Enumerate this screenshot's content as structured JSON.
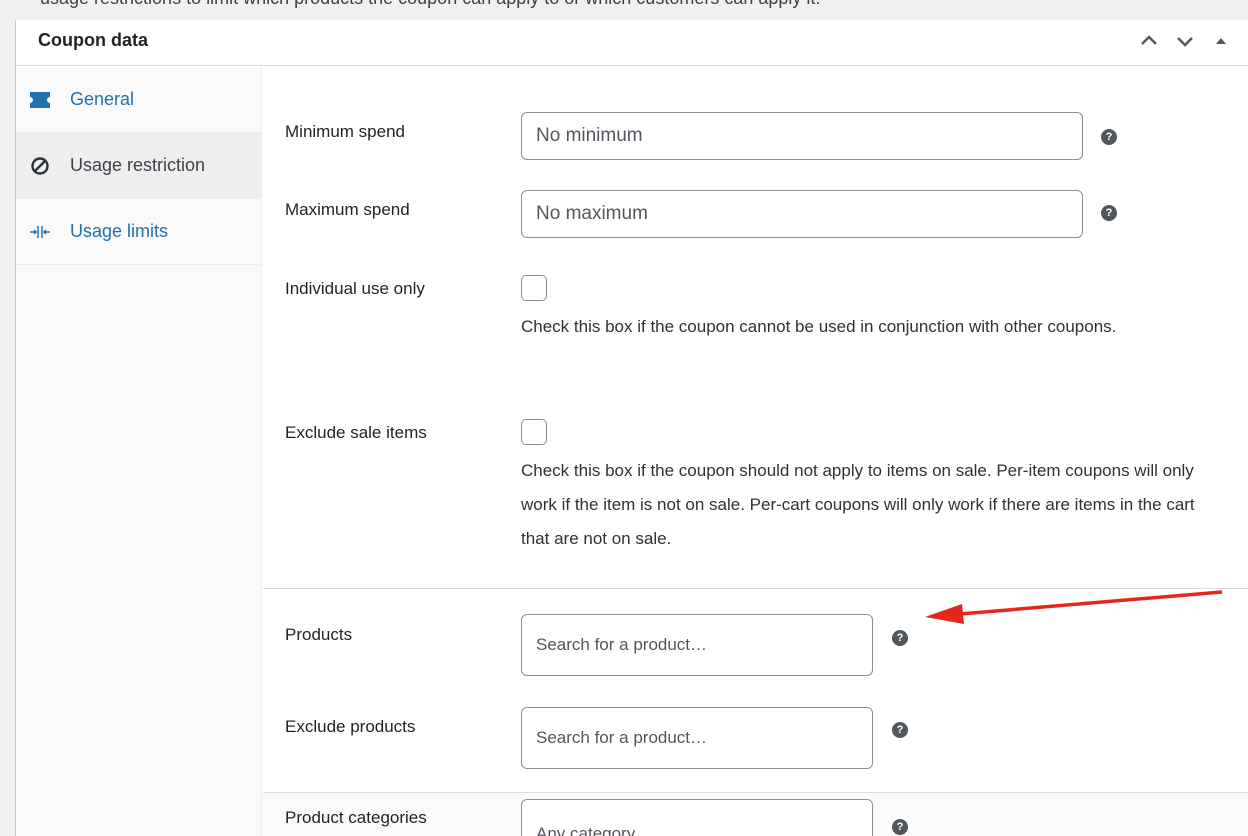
{
  "top_strip": {
    "clipped_text": "usage restrictions to limit which products the coupon can apply to or which customers can apply it."
  },
  "metabox": {
    "title": "Coupon data",
    "actions": [
      "move-up",
      "move-down",
      "toggle-panel"
    ]
  },
  "tabs": [
    {
      "label": "General",
      "icon": "ticket-icon",
      "active": false
    },
    {
      "label": "Usage restriction",
      "icon": "block-icon",
      "active": true
    },
    {
      "label": "Usage limits",
      "icon": "limits-icon",
      "active": false
    }
  ],
  "fields": {
    "minimum_spend": {
      "label": "Minimum spend",
      "placeholder": "No minimum"
    },
    "maximum_spend": {
      "label": "Maximum spend",
      "placeholder": "No maximum"
    },
    "individual_use": {
      "label": "Individual use only",
      "checked": false,
      "description": "Check this box if the coupon cannot be used in conjunction with other coupons."
    },
    "exclude_sale_items": {
      "label": "Exclude sale items",
      "checked": false,
      "description": "Check this box if the coupon should not apply to items on sale. Per-item coupons will only work if the item is not on sale. Per-cart coupons will only work if there are items in the cart that are not on sale."
    },
    "products": {
      "label": "Products",
      "placeholder": "Search for a product…"
    },
    "exclude_products": {
      "label": "Exclude products",
      "placeholder": "Search for a product…"
    },
    "product_categories": {
      "label": "Product categories",
      "placeholder": "Any category"
    }
  },
  "help_icon_glyph": "?",
  "annotation": {
    "type": "arrow",
    "color": "#e5261f",
    "points_to": "products-help-icon"
  }
}
